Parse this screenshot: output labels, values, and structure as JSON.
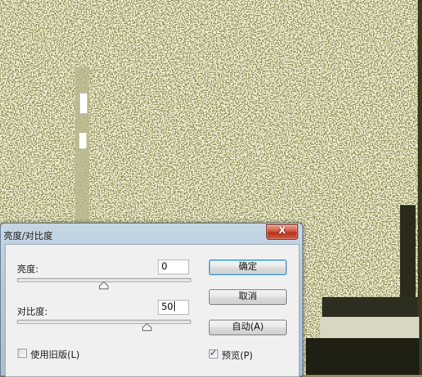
{
  "dialog": {
    "title": "亮度/对比度",
    "close_label": "X",
    "brightness": {
      "label": "亮度:",
      "value": "0",
      "slider_level": 0.5
    },
    "contrast": {
      "label": "对比度:",
      "value": "50",
      "slider_level": 0.75
    },
    "buttons": {
      "ok": "确定",
      "cancel": "取消",
      "auto": "自动(A)"
    },
    "use_legacy": {
      "label": "使用旧版(L)",
      "checked": false
    },
    "preview": {
      "label": "预览(P)",
      "checked": true
    }
  }
}
